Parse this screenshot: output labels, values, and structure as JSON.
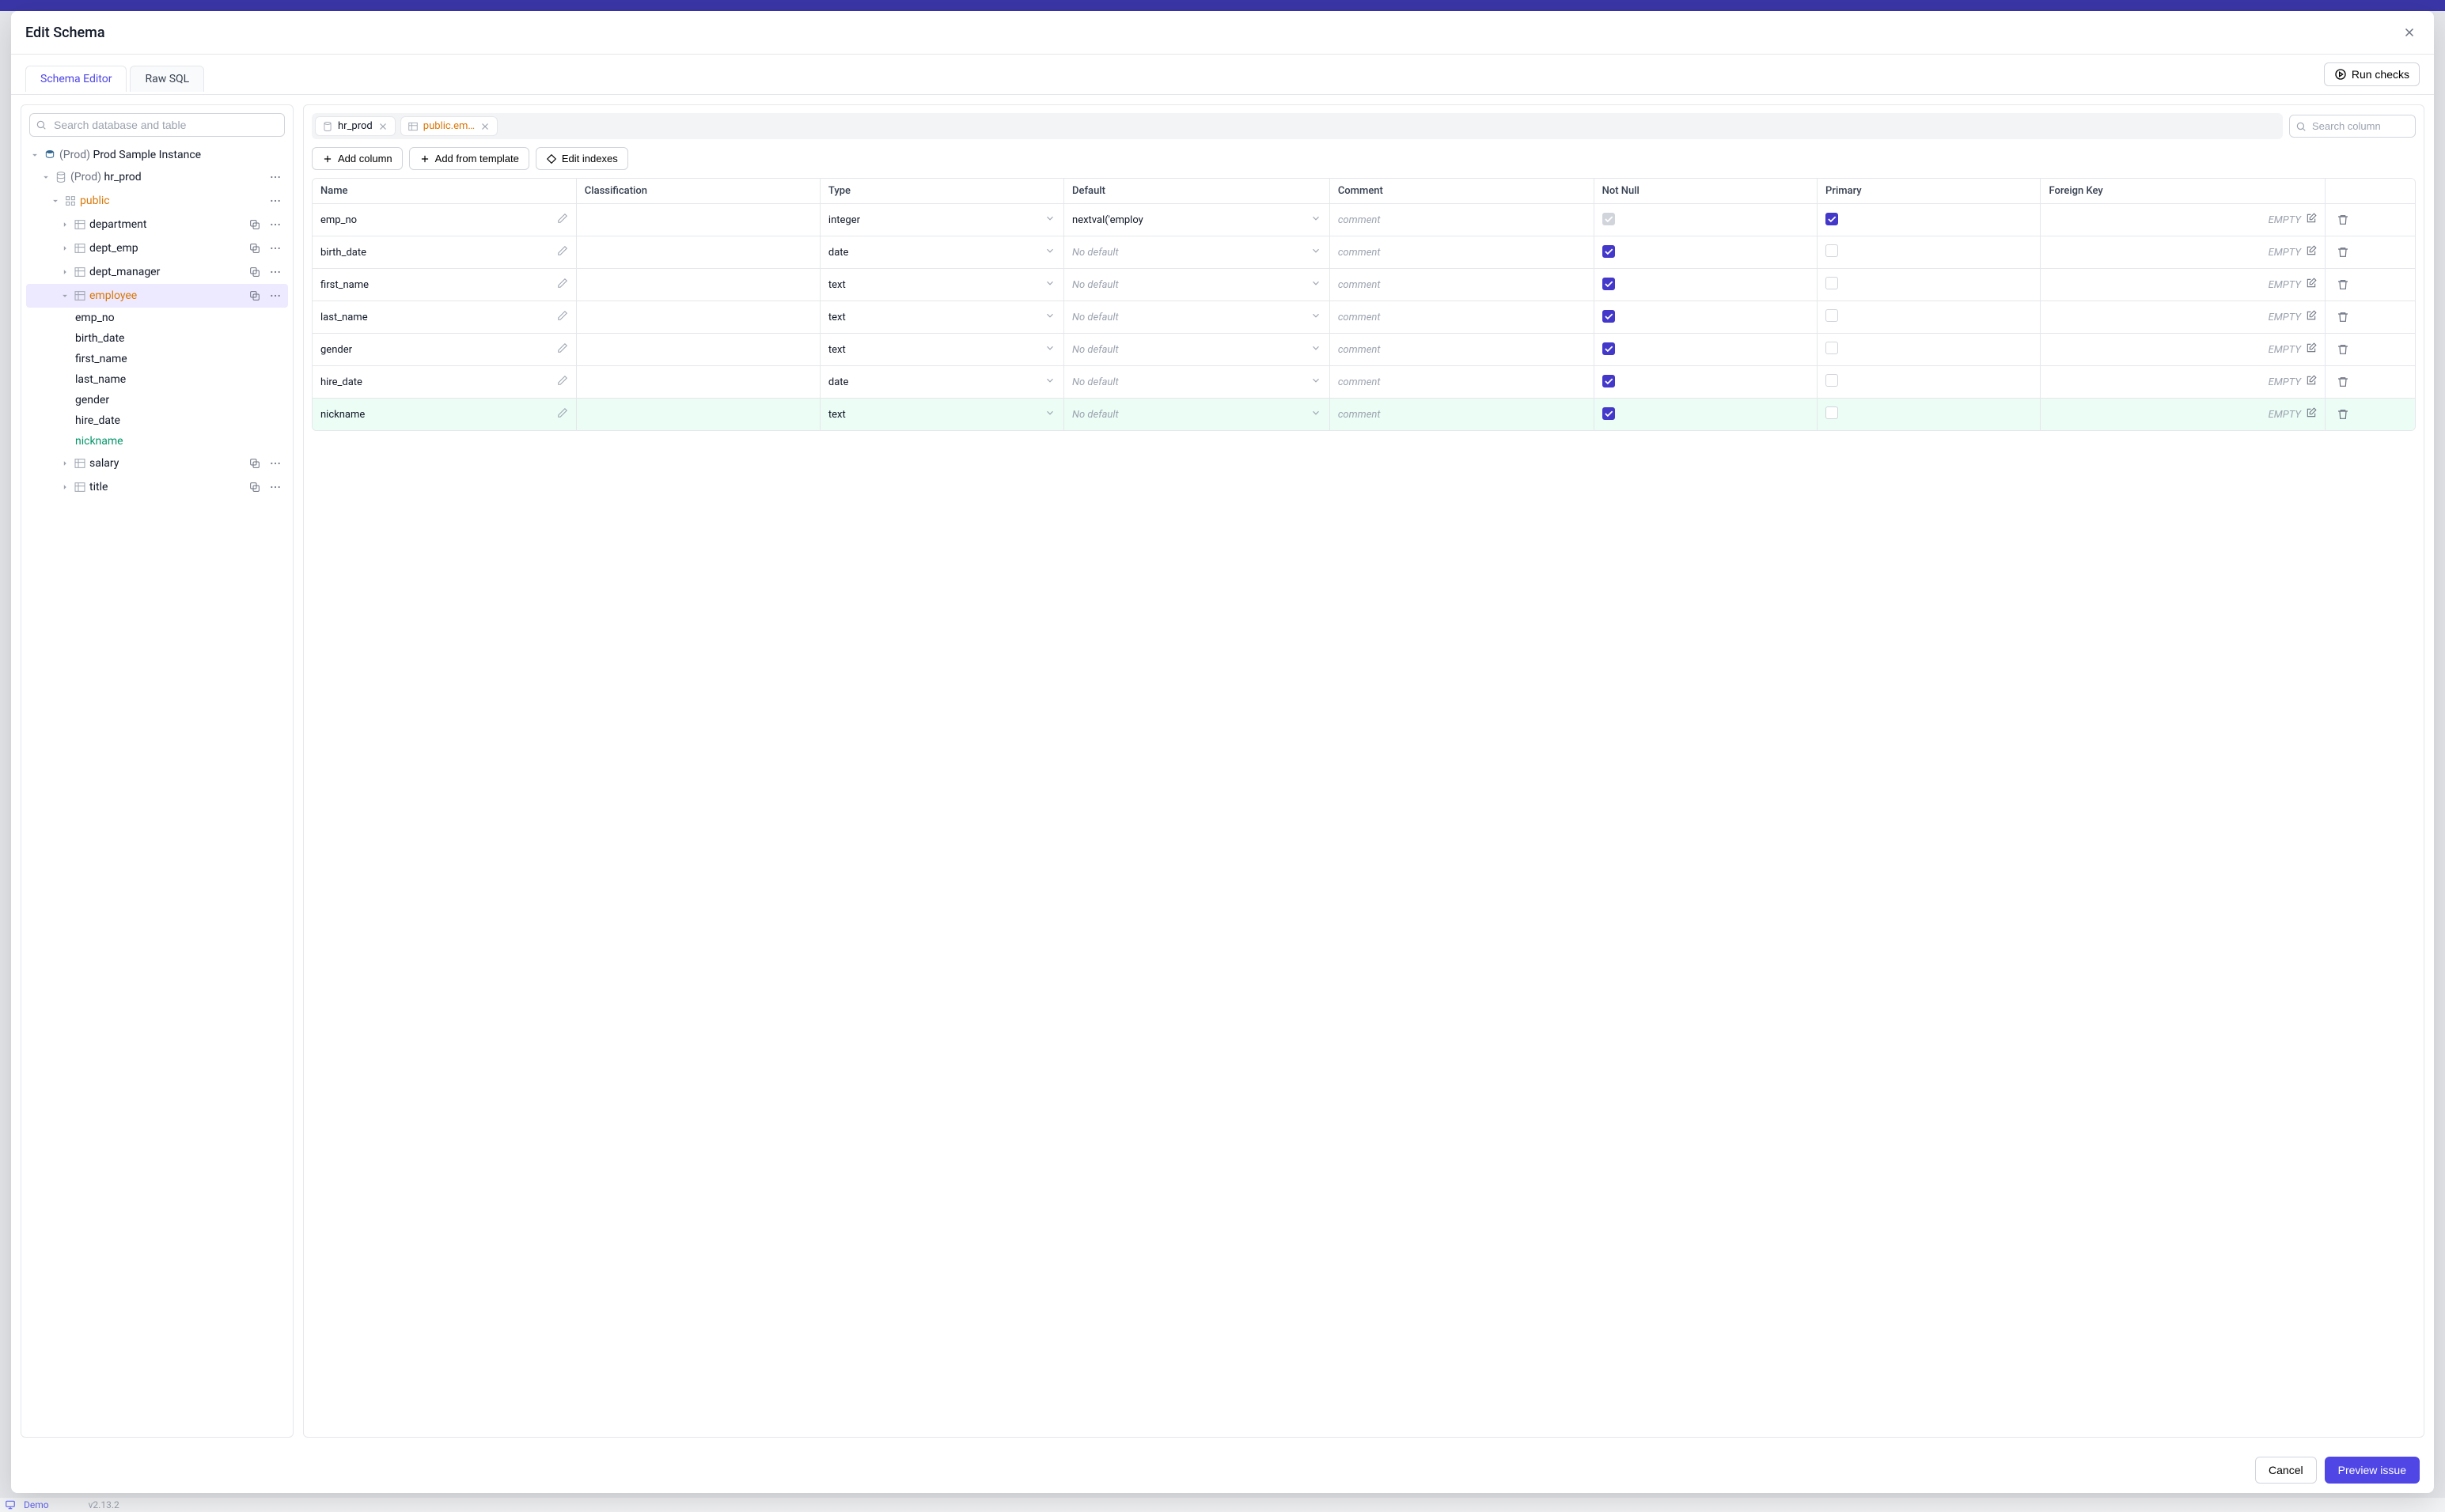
{
  "backdrop": {
    "demo": "Demo",
    "version": "v2.13.2"
  },
  "modal": {
    "title": "Edit Schema",
    "tabs": {
      "editor": "Schema Editor",
      "raw": "Raw SQL"
    },
    "run_checks": "Run checks",
    "footer": {
      "cancel": "Cancel",
      "preview": "Preview issue"
    }
  },
  "sidebar": {
    "search_placeholder": "Search database and table",
    "instance": {
      "prefix": "(Prod)",
      "name": "Prod Sample Instance"
    },
    "database": {
      "prefix": "(Prod)",
      "name": "hr_prod"
    },
    "schema": "public",
    "tables": [
      {
        "name": "department"
      },
      {
        "name": "dept_emp"
      },
      {
        "name": "dept_manager"
      },
      {
        "name": "employee",
        "selected": true,
        "columns": [
          "emp_no",
          "birth_date",
          "first_name",
          "last_name",
          "gender",
          "hire_date",
          {
            "name": "nickname",
            "new": true
          }
        ]
      },
      {
        "name": "salary"
      },
      {
        "name": "title"
      }
    ]
  },
  "breadcrumbs": {
    "db": "hr_prod",
    "table": "public.em…"
  },
  "col_search_placeholder": "Search column",
  "toolbar": {
    "add_column": "Add column",
    "add_from_template": "Add from template",
    "edit_indexes": "Edit indexes"
  },
  "table": {
    "headers": {
      "name": "Name",
      "classification": "Classification",
      "type": "Type",
      "default": "Default",
      "comment": "Comment",
      "not_null": "Not Null",
      "primary": "Primary",
      "foreign_key": "Foreign Key"
    },
    "placeholders": {
      "no_default": "No default",
      "comment": "comment",
      "empty": "EMPTY"
    },
    "rows": [
      {
        "name": "emp_no",
        "type": "integer",
        "default": "nextval('employ",
        "not_null": true,
        "not_null_locked": true,
        "primary": true
      },
      {
        "name": "birth_date",
        "type": "date",
        "default": "",
        "not_null": true,
        "primary": false
      },
      {
        "name": "first_name",
        "type": "text",
        "default": "",
        "not_null": true,
        "primary": false
      },
      {
        "name": "last_name",
        "type": "text",
        "default": "",
        "not_null": true,
        "primary": false
      },
      {
        "name": "gender",
        "type": "text",
        "default": "",
        "not_null": true,
        "primary": false
      },
      {
        "name": "hire_date",
        "type": "date",
        "default": "",
        "not_null": true,
        "primary": false
      },
      {
        "name": "nickname",
        "type": "text",
        "default": "",
        "not_null": true,
        "primary": false,
        "new": true
      }
    ]
  }
}
